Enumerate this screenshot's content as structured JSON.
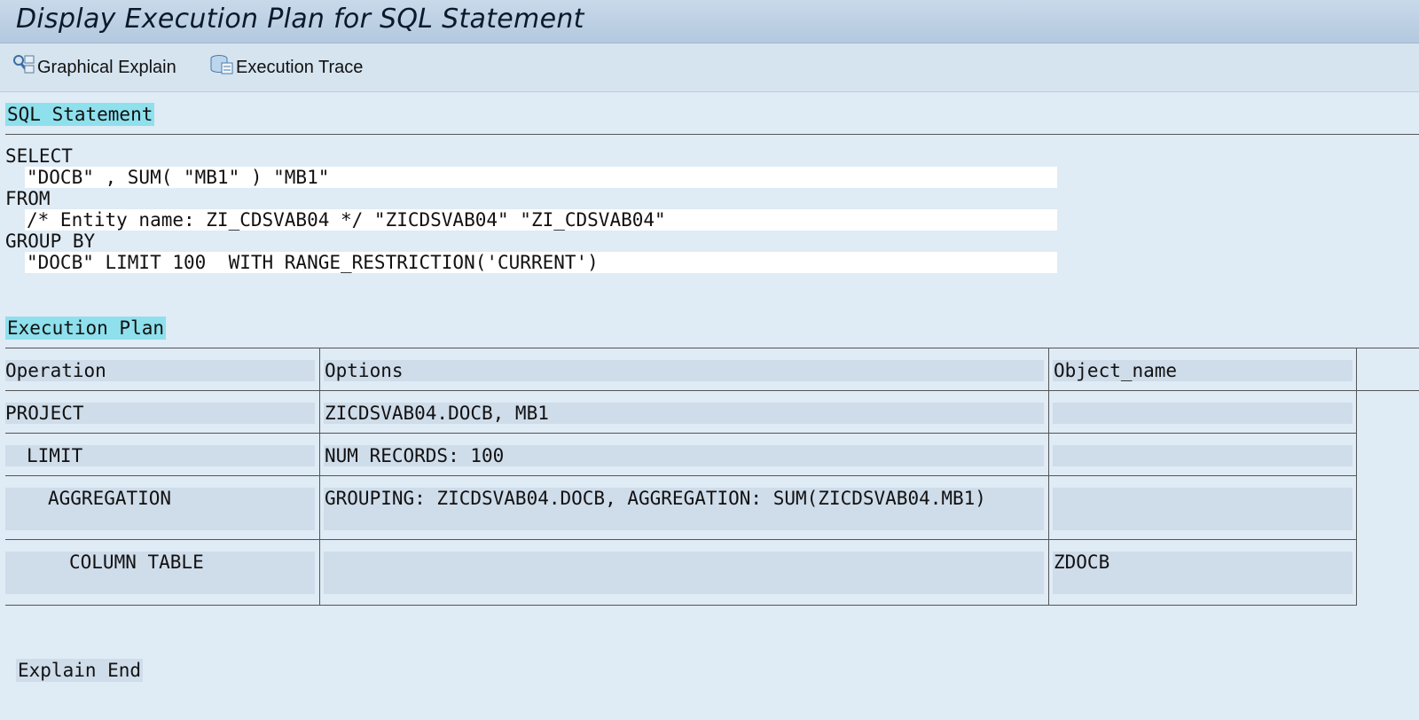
{
  "window": {
    "title": "Display Execution Plan for SQL Statement"
  },
  "toolbar": {
    "graphical_explain": "Graphical Explain",
    "execution_trace": "Execution Trace"
  },
  "sql_section": {
    "label": "SQL Statement",
    "lines": [
      "SELECT",
      "\"DOCB\" , SUM( \"MB1\" ) \"MB1\"",
      "FROM",
      "/* Entity name: ZI_CDSVAB04 */ \"ZICDSVAB04\" \"ZI_CDSVAB04\"",
      "GROUP BY",
      "\"DOCB\" LIMIT 100  WITH RANGE_RESTRICTION('CURRENT')"
    ]
  },
  "plan_section": {
    "label": "Execution Plan",
    "columns": [
      "Operation",
      "Options",
      "Object_name"
    ],
    "rows": [
      {
        "operation": "PROJECT",
        "options": "ZICDSVAB04.DOCB, MB1",
        "object_name": ""
      },
      {
        "operation": "LIMIT",
        "options": "NUM RECORDS: 100",
        "object_name": ""
      },
      {
        "operation": "AGGREGATION",
        "options": "GROUPING: ZICDSVAB04.DOCB, AGGREGATION: SUM(ZICDSVAB04.MB1)",
        "object_name": ""
      },
      {
        "operation": "COLUMN TABLE",
        "options": "",
        "object_name": "ZDOCB"
      }
    ]
  },
  "footer": {
    "end_label": "Explain End"
  },
  "colors": {
    "accent": "#8ee0ec",
    "background": "#dfebf5",
    "title_bar": "#b3c9df"
  }
}
